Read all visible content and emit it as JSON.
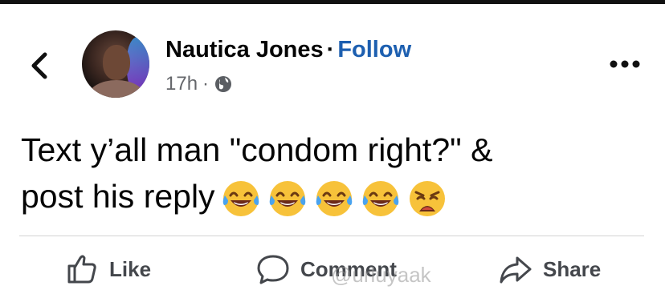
{
  "post": {
    "author": "Nautica Jones",
    "separator": "·",
    "follow_label": "Follow",
    "time": "17h",
    "meta_separator": "·",
    "audience_icon": "globe-icon",
    "text_line1": "Text y’all man \"condom right?\" &",
    "text_line2": "post his reply",
    "emojis": [
      "face-with-tears-of-joy",
      "face-with-tears-of-joy",
      "face-with-tears-of-joy",
      "face-with-tears-of-joy",
      "weary-face"
    ]
  },
  "actions": {
    "like_label": "Like",
    "comment_label": "Comment",
    "share_label": "Share"
  },
  "watermark": {
    "text": "@urluyaak"
  },
  "icons": {
    "back": "chevron-left-icon",
    "more": "more-options-icon"
  },
  "colors": {
    "accent": "#1d5fb0",
    "text": "#050505",
    "secondary": "#65676b",
    "emoji_yellow": "#f7c23a"
  }
}
